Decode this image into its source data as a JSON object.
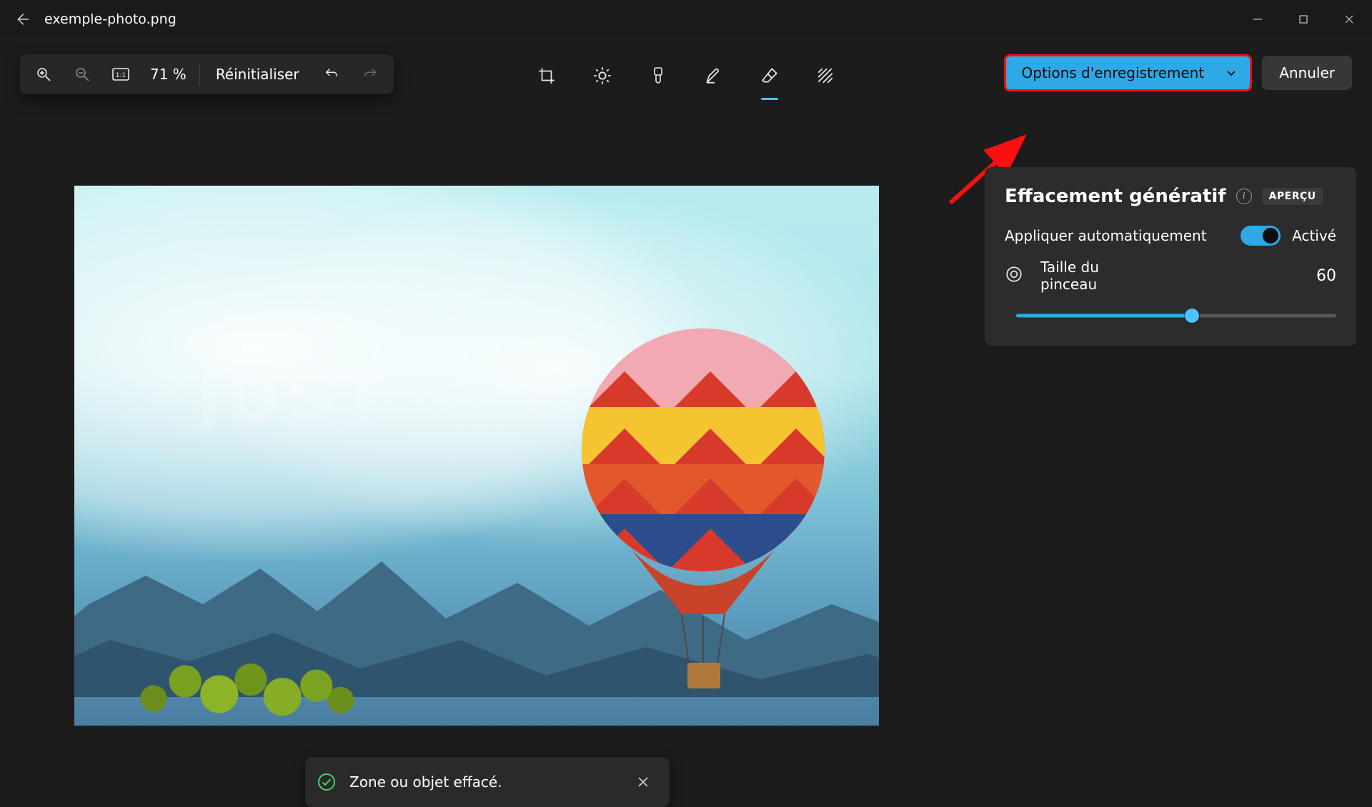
{
  "titlebar": {
    "filename": "exemple-photo.png"
  },
  "toolbar": {
    "zoom_percent": "71 %",
    "reset_label": "Réinitialiser",
    "save_options_label": "Options d'enregistrement",
    "cancel_label": "Annuler",
    "center_tools": [
      {
        "name": "crop"
      },
      {
        "name": "adjust"
      },
      {
        "name": "filter"
      },
      {
        "name": "markup"
      },
      {
        "name": "erase",
        "active": true
      },
      {
        "name": "bgremove"
      }
    ]
  },
  "canvas": {
    "watermark": "JUST"
  },
  "toast": {
    "message": "Zone ou objet effacé."
  },
  "panel": {
    "title": "Effacement génératif",
    "badge": "APERÇU",
    "auto_apply_label": "Appliquer automatiquement",
    "toggle_state": "Activé",
    "brush_size_label": "Taille du pinceau",
    "brush_size_value": "60",
    "brush_size_percent": 55
  }
}
